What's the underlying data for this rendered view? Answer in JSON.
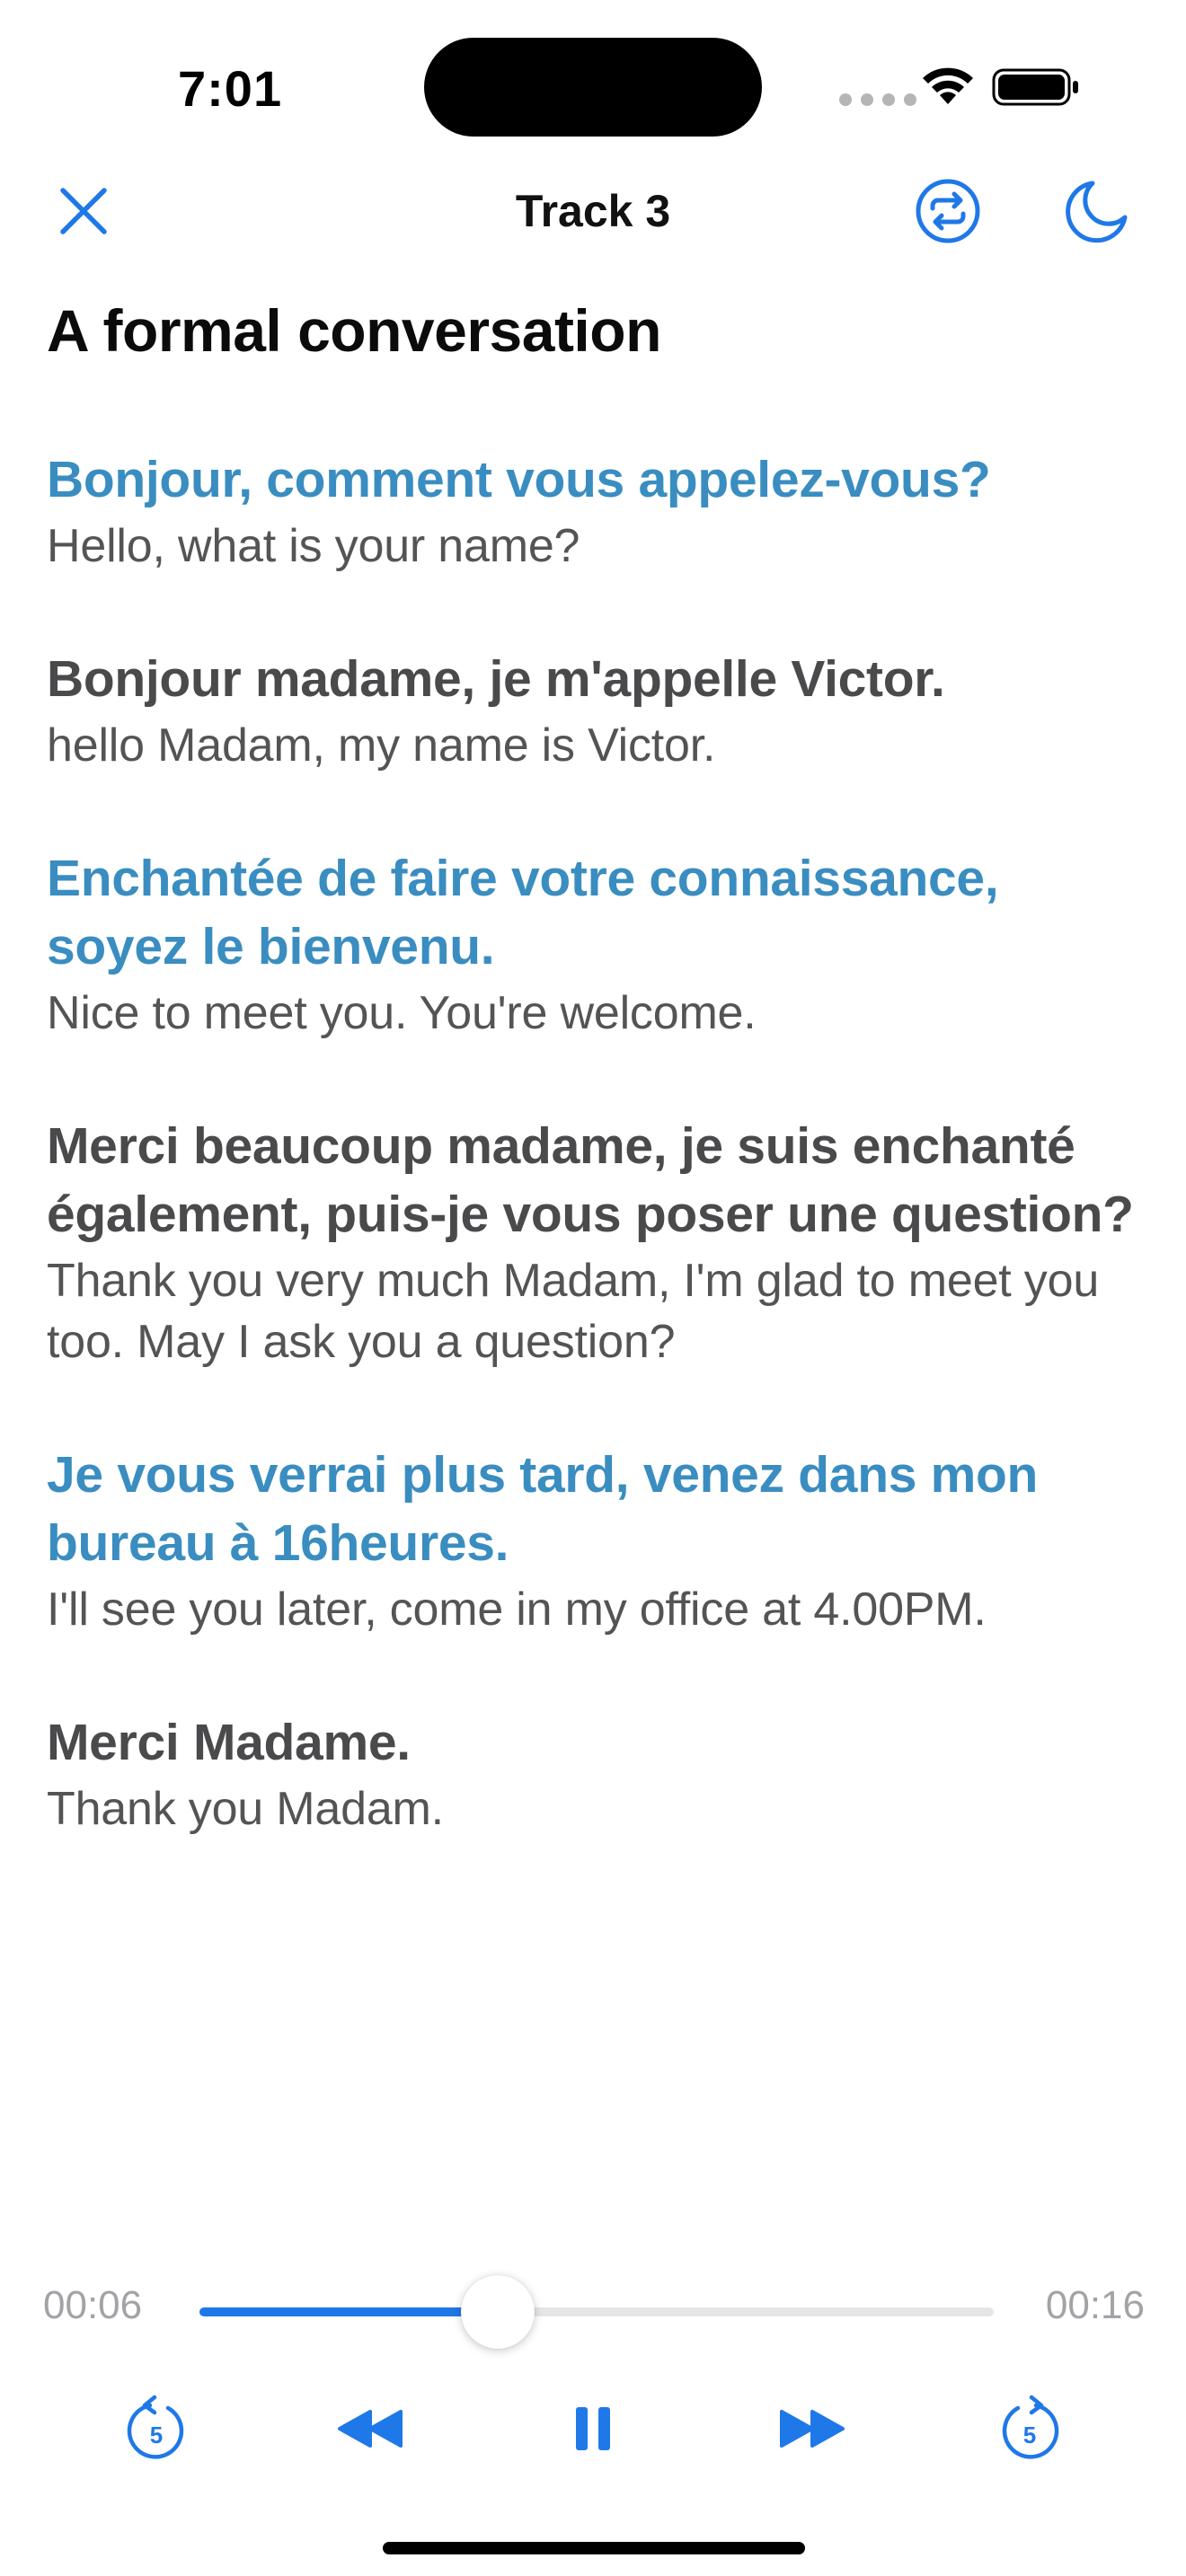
{
  "status": {
    "time": "7:01"
  },
  "nav": {
    "title": "Track 3"
  },
  "lesson": {
    "title": "A formal conversation"
  },
  "lines": [
    {
      "fr": "Bonjour, comment vous appelez-vous?",
      "en": "Hello, what is your name?",
      "speaker": "a"
    },
    {
      "fr": "Bonjour madame, je m'appelle Victor.",
      "en": "hello Madam, my name is Victor.",
      "speaker": "b"
    },
    {
      "fr": "Enchantée de faire votre connaissance, soyez le bienvenu.",
      "en": "Nice to meet you. You're welcome.",
      "speaker": "a"
    },
    {
      "fr": "Merci beaucoup madame, je suis enchanté également, puis-je vous poser une question?",
      "en": "Thank you very much Madam, I'm glad to meet you too. May I ask you a question?",
      "speaker": "b"
    },
    {
      "fr": "Je vous verrai plus tard, venez dans mon bureau à 16heures.",
      "en": "I'll see you later, come in my office at 4.00PM.",
      "speaker": "a"
    },
    {
      "fr": "Merci Madame.",
      "en": "Thank you Madam.",
      "speaker": "b"
    }
  ],
  "player": {
    "current_time": "00:06",
    "total_time": "00:16",
    "progress": 0.375,
    "skip_back_seconds": "5",
    "skip_forward_seconds": "5",
    "state": "playing"
  },
  "colors": {
    "accent": "#1f78e8",
    "french_speaker_a": "#3a8dc0",
    "french_speaker_b": "#4a4a4c",
    "english_text": "#545456"
  },
  "icons": [
    "close-icon",
    "repeat-icon",
    "moon-icon",
    "skip-back-5-icon",
    "rewind-icon",
    "pause-icon",
    "fast-forward-icon",
    "skip-forward-5-icon"
  ]
}
